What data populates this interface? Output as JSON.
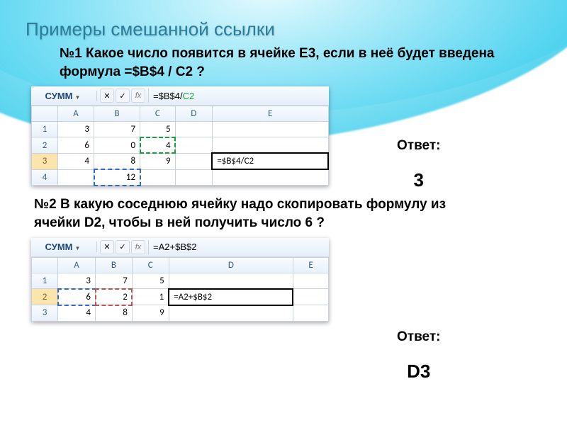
{
  "title": "Примеры смешанной ссылки",
  "q1": {
    "text": "№1 Какое число появится в ячейке E3, если в неё будет введена формула =$B$4 / C2 ?",
    "answer_label": "Ответ:",
    "answer_value": "3",
    "namebox": "СУММ",
    "formula_plain": "=$B$4/",
    "formula_c2": "C2",
    "fx_cancel": "✕",
    "fx_enter": "✓",
    "fx_label": "fx",
    "headers": [
      "",
      "A",
      "B",
      "C",
      "D",
      "E"
    ],
    "rows": [
      {
        "n": "1",
        "A": "3",
        "B": "7",
        "C": "5",
        "D": "",
        "E": ""
      },
      {
        "n": "2",
        "A": "6",
        "B": "0",
        "C": "4",
        "D": "",
        "E": ""
      },
      {
        "n": "3",
        "A": "4",
        "B": "8",
        "C": "9",
        "D": "",
        "E": "=$B$4/C2"
      },
      {
        "n": "4",
        "A": "",
        "B": "12",
        "C": "",
        "D": "",
        "E": ""
      }
    ]
  },
  "q2": {
    "text": "№2 В какую соседнюю ячейку надо скопировать формулу из ячейки D2, чтобы в ней получить число 6 ?",
    "answer_label": "Ответ:",
    "answer_value": "D3",
    "namebox": "СУММ",
    "formula_a2": "=A2",
    "formula_plus": "+$B$2",
    "fx_cancel": "✕",
    "fx_enter": "✓",
    "fx_label": "fx",
    "headers": [
      "",
      "A",
      "B",
      "C",
      "D",
      "E"
    ],
    "rows": [
      {
        "n": "1",
        "A": "3",
        "B": "7",
        "C": "5",
        "D": "",
        "E": ""
      },
      {
        "n": "2",
        "A": "6",
        "B": "2",
        "C": "1",
        "D": "=A2+$B$2",
        "E": ""
      },
      {
        "n": "3",
        "A": "4",
        "B": "8",
        "C": "9",
        "D": "",
        "E": ""
      }
    ]
  }
}
